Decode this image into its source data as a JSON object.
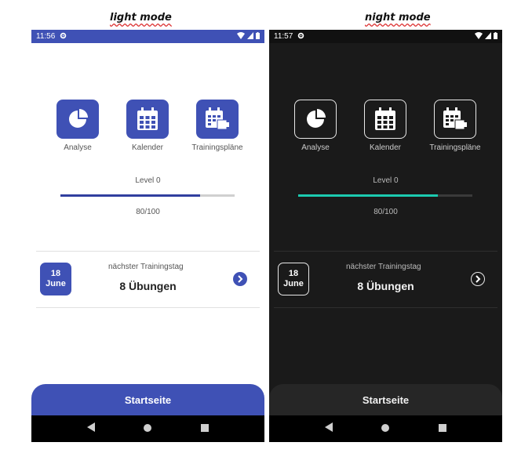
{
  "captions": {
    "light": "light mode",
    "dark": "night mode"
  },
  "light": {
    "status": {
      "time": "11:56"
    },
    "tiles": [
      {
        "label": "Analyse",
        "icon": "pie-chart-icon"
      },
      {
        "label": "Kalender",
        "icon": "calendar-icon"
      },
      {
        "label": "Trainingspläne",
        "icon": "training-plans-icon"
      }
    ],
    "level": "Level 0",
    "progress": 0.8,
    "score": "80/100",
    "next": {
      "label": "nächster Trainingstag",
      "day": "18",
      "month": "June",
      "exercises": "8 Übungen"
    },
    "home_button": "Startseite"
  },
  "dark": {
    "status": {
      "time": "11:57"
    },
    "tiles": [
      {
        "label": "Analyse",
        "icon": "pie-chart-icon"
      },
      {
        "label": "Kalender",
        "icon": "calendar-icon"
      },
      {
        "label": "Trainingspläne",
        "icon": "training-plans-icon"
      }
    ],
    "level": "Level 0",
    "progress": 0.8,
    "score": "80/100",
    "next": {
      "label": "nächster Trainingstag",
      "day": "18",
      "month": "June",
      "exercises": "8 Übungen"
    },
    "home_button": "Startseite"
  },
  "colors": {
    "accent_light": "#3f51b5",
    "accent_dark": "#1ccab0"
  }
}
